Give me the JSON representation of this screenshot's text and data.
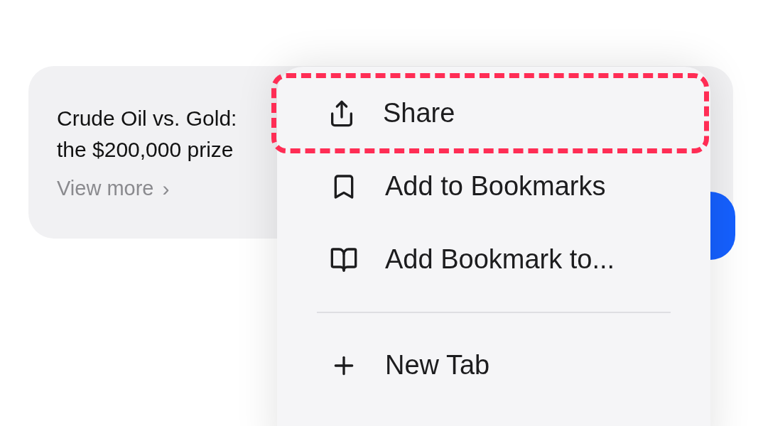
{
  "card": {
    "title_lines": [
      "Crude Oil vs. Gold:",
      "the $200,000 prize"
    ],
    "link": "View more",
    "link_arrow": "›"
  },
  "menu": {
    "items": [
      {
        "kind": "item",
        "label": "Share",
        "highlighted": true
      },
      {
        "kind": "item",
        "label": "Add to Bookmarks",
        "highlighted": false
      },
      {
        "kind": "item",
        "label": "Add Bookmark to...",
        "highlighted": false
      },
      {
        "kind": "divider"
      },
      {
        "kind": "item",
        "label": "New Tab",
        "highlighted": false
      }
    ]
  }
}
